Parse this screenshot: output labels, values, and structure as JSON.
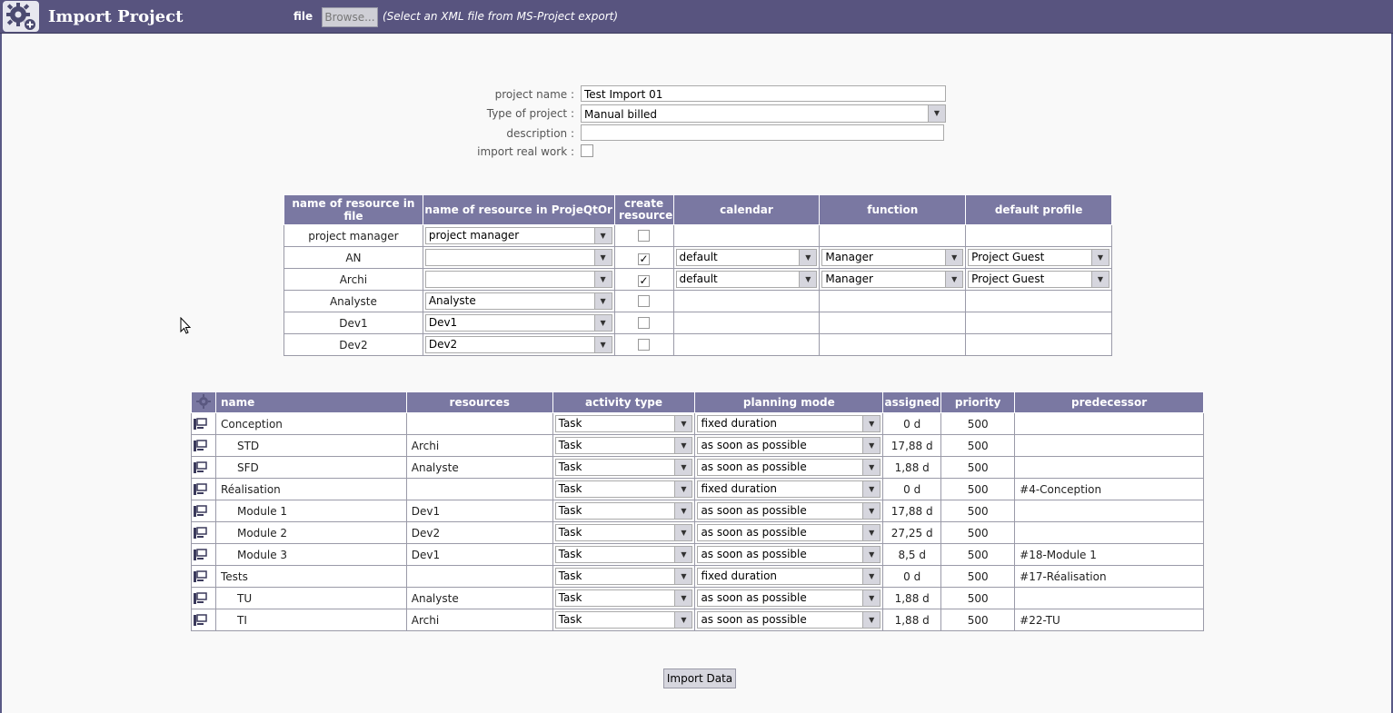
{
  "header": {
    "title": "Import Project",
    "file_label": "file",
    "browse_label": "Browse...",
    "hint": "(Select an XML file from MS-Project export)"
  },
  "form": {
    "project_name_label": "project name :",
    "project_name_value": "Test Import 01",
    "type_label": "Type of project :",
    "type_value": "Manual billed",
    "description_label": "description :",
    "description_value": "",
    "import_real_work_label": "import real work :",
    "import_real_work_checked": false
  },
  "resources_table": {
    "headers": [
      "name of resource in file",
      "name of resource in ProjeQtOr",
      "create resource",
      "calendar",
      "function",
      "default profile"
    ],
    "rows": [
      {
        "file_name": "project manager",
        "projeqtor_name": "project manager",
        "create": false,
        "calendar": "",
        "function": "",
        "profile": ""
      },
      {
        "file_name": "AN",
        "projeqtor_name": "",
        "create": true,
        "calendar": "default",
        "function": "Manager",
        "profile": "Project Guest"
      },
      {
        "file_name": "Archi",
        "projeqtor_name": "",
        "create": true,
        "calendar": "default",
        "function": "Manager",
        "profile": "Project Guest"
      },
      {
        "file_name": "Analyste",
        "projeqtor_name": "Analyste",
        "create": false,
        "calendar": "",
        "function": "",
        "profile": ""
      },
      {
        "file_name": "Dev1",
        "projeqtor_name": "Dev1",
        "create": false,
        "calendar": "",
        "function": "",
        "profile": ""
      },
      {
        "file_name": "Dev2",
        "projeqtor_name": "Dev2",
        "create": false,
        "calendar": "",
        "function": "",
        "profile": ""
      }
    ]
  },
  "activities_table": {
    "headers": [
      "name",
      "resources",
      "activity type",
      "planning mode",
      "assigned",
      "priority",
      "predecessor"
    ],
    "rows": [
      {
        "name": "Conception",
        "indent": false,
        "resources": "",
        "type": "Task",
        "mode": "fixed duration",
        "assigned": "0 d",
        "priority": "500",
        "predecessor": ""
      },
      {
        "name": "STD",
        "indent": true,
        "resources": "Archi",
        "type": "Task",
        "mode": "as soon as possible",
        "assigned": "17,88 d",
        "priority": "500",
        "predecessor": ""
      },
      {
        "name": "SFD",
        "indent": true,
        "resources": "Analyste",
        "type": "Task",
        "mode": "as soon as possible",
        "assigned": "1,88 d",
        "priority": "500",
        "predecessor": ""
      },
      {
        "name": "Réalisation",
        "indent": false,
        "resources": "",
        "type": "Task",
        "mode": "fixed duration",
        "assigned": "0 d",
        "priority": "500",
        "predecessor": "#4-Conception"
      },
      {
        "name": "Module 1",
        "indent": true,
        "resources": "Dev1",
        "type": "Task",
        "mode": "as soon as possible",
        "assigned": "17,88 d",
        "priority": "500",
        "predecessor": ""
      },
      {
        "name": "Module 2",
        "indent": true,
        "resources": "Dev2",
        "type": "Task",
        "mode": "as soon as possible",
        "assigned": "27,25 d",
        "priority": "500",
        "predecessor": ""
      },
      {
        "name": "Module 3",
        "indent": true,
        "resources": "Dev1",
        "type": "Task",
        "mode": "as soon as possible",
        "assigned": "8,5 d",
        "priority": "500",
        "predecessor": "#18-Module 1"
      },
      {
        "name": "Tests",
        "indent": false,
        "resources": "",
        "type": "Task",
        "mode": "fixed duration",
        "assigned": "0 d",
        "priority": "500",
        "predecessor": "#17-Réalisation"
      },
      {
        "name": "TU",
        "indent": true,
        "resources": "Analyste",
        "type": "Task",
        "mode": "as soon as possible",
        "assigned": "1,88 d",
        "priority": "500",
        "predecessor": ""
      },
      {
        "name": "TI",
        "indent": true,
        "resources": "Archi",
        "type": "Task",
        "mode": "as soon as possible",
        "assigned": "1,88 d",
        "priority": "500",
        "predecessor": "#22-TU"
      }
    ]
  },
  "footer": {
    "import_label": "Import Data"
  },
  "colors": {
    "header_bg": "#58547f",
    "table_header_bg": "#7a78a2"
  }
}
